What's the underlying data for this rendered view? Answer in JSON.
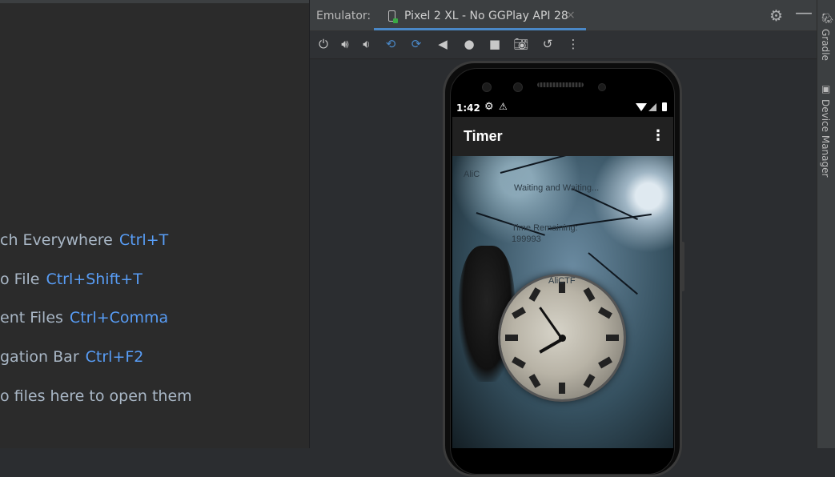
{
  "editor": {
    "hints": [
      {
        "text": "ch Everywhere",
        "key": "Ctrl+T"
      },
      {
        "text": "o File",
        "key": "Ctrl+Shift+T"
      },
      {
        "text": "ent Files",
        "key": "Ctrl+Comma"
      },
      {
        "text": "gation Bar",
        "key": "Ctrl+F2"
      },
      {
        "text": "o files here to open them",
        "key": ""
      }
    ]
  },
  "emulator": {
    "label": "Emulator:",
    "tab_title": "Pixel 2 XL - No GGPlay API 28",
    "tab_close": "×",
    "toolbar_icons": [
      "power-icon",
      "volume-up-icon",
      "volume-down-icon",
      "rotate-left-icon",
      "rotate-right-icon",
      "back-icon",
      "home-icon",
      "overview-icon",
      "camera-icon",
      "snapshot-icon",
      "more-vert-icon"
    ]
  },
  "device": {
    "status_time": "1:42",
    "app_title": "Timer",
    "content": {
      "label_top_left": "AliC",
      "waiting_text": "Waiting and Waiting...",
      "time_remaining_label": "Time Remaining:",
      "time_remaining_value": "199993",
      "clock_label": "AliCTF"
    }
  },
  "tool_windows": {
    "gradle": "Gradle",
    "device_manager": "Device Manager"
  },
  "colors": {
    "accent": "#4a88c7",
    "shortcut": "#589df6",
    "background": "#2b2d30"
  }
}
